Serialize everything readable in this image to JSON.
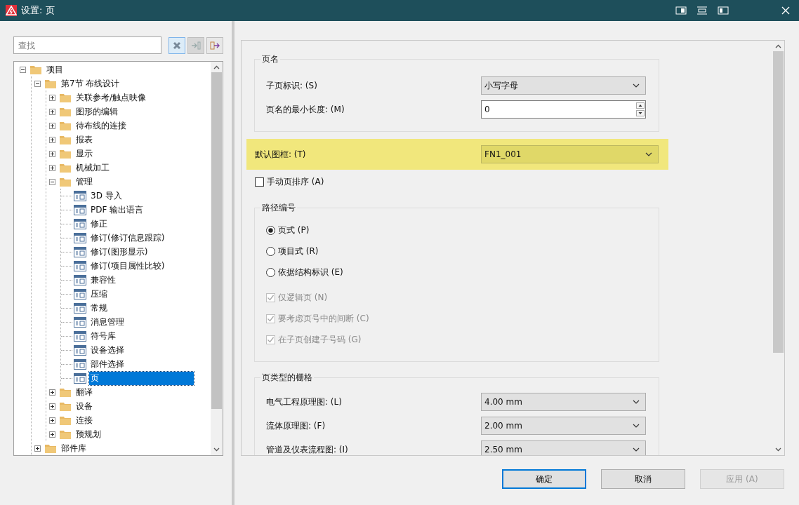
{
  "window": {
    "title": "设置: 页"
  },
  "search": {
    "placeholder": "查找"
  },
  "search_buttons": [
    {
      "kind": "clear",
      "disabled": false
    },
    {
      "kind": "enter",
      "disabled": true
    },
    {
      "kind": "exit",
      "disabled": false
    }
  ],
  "tree": [
    {
      "label": "项目",
      "kind": "folder",
      "expanded": true,
      "selected": false,
      "children": [
        {
          "label": "第7节 布线设计",
          "kind": "folder",
          "expanded": true,
          "selected": false,
          "children": [
            {
              "label": "关联参考/触点映像",
              "kind": "folder",
              "expanded": false,
              "selected": false
            },
            {
              "label": "图形的编辑",
              "kind": "folder",
              "expanded": false,
              "selected": false
            },
            {
              "label": "待布线的连接",
              "kind": "folder",
              "expanded": false,
              "selected": false
            },
            {
              "label": "报表",
              "kind": "folder",
              "expanded": false,
              "selected": false
            },
            {
              "label": "显示",
              "kind": "folder",
              "expanded": false,
              "selected": false
            },
            {
              "label": "机械加工",
              "kind": "folder",
              "expanded": false,
              "selected": false
            },
            {
              "label": "管理",
              "kind": "folder",
              "expanded": true,
              "selected": false,
              "children": [
                {
                  "label": "3D 导入",
                  "kind": "page",
                  "selected": false
                },
                {
                  "label": "PDF 输出语言",
                  "kind": "page",
                  "selected": false
                },
                {
                  "label": "修正",
                  "kind": "page",
                  "selected": false
                },
                {
                  "label": "修订(修订信息跟踪)",
                  "kind": "page",
                  "selected": false
                },
                {
                  "label": "修订(图形显示)",
                  "kind": "page",
                  "selected": false
                },
                {
                  "label": "修订(项目属性比较)",
                  "kind": "page",
                  "selected": false
                },
                {
                  "label": "兼容性",
                  "kind": "page",
                  "selected": false
                },
                {
                  "label": "压缩",
                  "kind": "page",
                  "selected": false
                },
                {
                  "label": "常规",
                  "kind": "page",
                  "selected": false
                },
                {
                  "label": "消息管理",
                  "kind": "page",
                  "selected": false
                },
                {
                  "label": "符号库",
                  "kind": "page",
                  "selected": false
                },
                {
                  "label": "设备选择",
                  "kind": "page",
                  "selected": false
                },
                {
                  "label": "部件选择",
                  "kind": "page",
                  "selected": false
                },
                {
                  "label": "页",
                  "kind": "page",
                  "selected": true
                }
              ]
            },
            {
              "label": "翻译",
              "kind": "folder",
              "expanded": false,
              "selected": false
            },
            {
              "label": "设备",
              "kind": "folder",
              "expanded": false,
              "selected": false
            },
            {
              "label": "连接",
              "kind": "folder",
              "expanded": false,
              "selected": false
            },
            {
              "label": "预规划",
              "kind": "folder",
              "expanded": false,
              "selected": false
            }
          ]
        },
        {
          "label": "部件库",
          "kind": "folder",
          "expanded": false,
          "selected": false
        }
      ]
    }
  ],
  "page_name_group": {
    "title": "页名",
    "rows": [
      {
        "label": "子页标识: (S)",
        "kind": "dropdown",
        "value": "小写字母"
      },
      {
        "label": "页名的最小长度: (M)",
        "kind": "spinner",
        "value": "0"
      }
    ]
  },
  "default_frame": {
    "label": "默认图框: (T)",
    "value": "FN1_001",
    "highlighted": true
  },
  "manual_sort": {
    "label": "手动页排序 (A)",
    "checked": false
  },
  "path_numbering": {
    "title": "路径编号",
    "options": [
      {
        "label": "页式 (P)",
        "selected": true
      },
      {
        "label": "项目式 (R)",
        "selected": false
      },
      {
        "label": "依据结构标识 (E)",
        "selected": false
      }
    ],
    "checks": [
      {
        "label": "仅逻辑页 (N)",
        "checked": true,
        "disabled": true
      },
      {
        "label": "要考虑页号中的间断 (C)",
        "checked": true,
        "disabled": true
      },
      {
        "label": "在子页创建子号码 (G)",
        "checked": true,
        "disabled": true
      }
    ]
  },
  "grid_group": {
    "title": "页类型的栅格",
    "rows": [
      {
        "label": "电气工程原理图: (L)",
        "kind": "dropdown",
        "value": "4.00 mm"
      },
      {
        "label": "流体原理图: (F)",
        "kind": "dropdown",
        "value": "2.00 mm"
      },
      {
        "label": "管道及仪表流程图: (I)",
        "kind": "dropdown",
        "value": "2.50 mm"
      }
    ]
  },
  "buttons": [
    {
      "label": "确定",
      "kind": "default",
      "disabled": false
    },
    {
      "label": "取消",
      "kind": "normal",
      "disabled": false
    },
    {
      "label": "应用 (A)",
      "kind": "normal",
      "disabled": true
    }
  ]
}
